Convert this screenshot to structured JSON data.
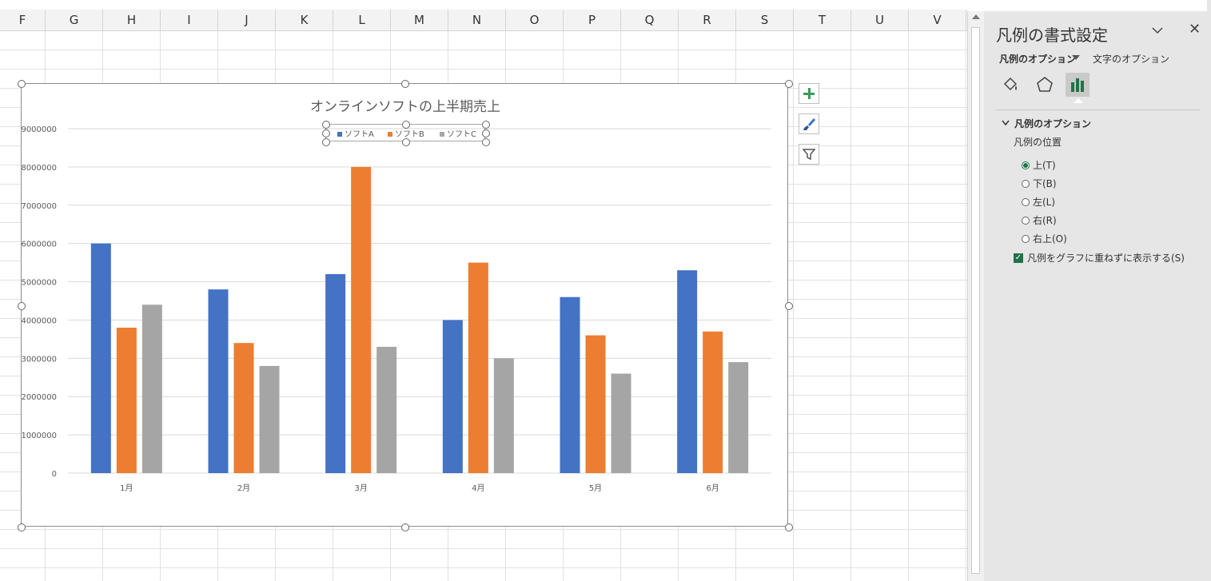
{
  "sheet": {
    "columns": [
      "F",
      "G",
      "H",
      "I",
      "J",
      "K",
      "L",
      "M",
      "N",
      "O",
      "P",
      "Q",
      "R",
      "S",
      "T",
      "U",
      "V"
    ]
  },
  "chart_data": {
    "type": "bar",
    "title": "オンラインソフトの上半期売上",
    "categories": [
      "1月",
      "2月",
      "3月",
      "4月",
      "5月",
      "6月"
    ],
    "series": [
      {
        "name": "ソフトA",
        "color": "#4472C4",
        "values": [
          6000000,
          4800000,
          5200000,
          4000000,
          4600000,
          5300000
        ]
      },
      {
        "name": "ソフトB",
        "color": "#ED7D31",
        "values": [
          3800000,
          3400000,
          8000000,
          5500000,
          3600000,
          3700000
        ]
      },
      {
        "name": "ソフトC",
        "color": "#A5A5A5",
        "values": [
          4400000,
          2800000,
          3300000,
          3000000,
          2600000,
          2900000
        ]
      }
    ],
    "ylim": [
      0,
      9000000
    ],
    "yticks": [
      "0",
      "1000000",
      "2000000",
      "3000000",
      "4000000",
      "5000000",
      "6000000",
      "7000000",
      "8000000",
      "9000000"
    ],
    "grid": true,
    "legend_position": "top"
  },
  "chart_buttons": {
    "add": "chart-elements",
    "style": "chart-styles",
    "filter": "chart-filters"
  },
  "panel": {
    "title": "凡例の書式設定",
    "collapse_icon": "chevron-down-icon",
    "close_label": "✕",
    "tab_legend_options": "凡例のオプション",
    "tab_text_options": "文字のオプション",
    "section_title": "凡例のオプション",
    "position_label": "凡例の位置",
    "positions": [
      {
        "label": "上(T)",
        "selected": true
      },
      {
        "label": "下(B)",
        "selected": false
      },
      {
        "label": "左(L)",
        "selected": false
      },
      {
        "label": "右(R)",
        "selected": false
      },
      {
        "label": "右上(O)",
        "selected": false
      }
    ],
    "overlap_label": "凡例をグラフに重ねずに表示する(S)",
    "overlap_checked": true,
    "accent": "#217346"
  }
}
